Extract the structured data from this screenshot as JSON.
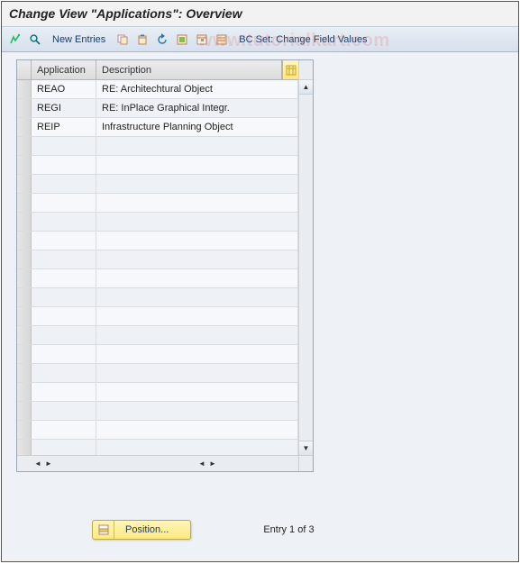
{
  "title": "Change View \"Applications\": Overview",
  "toolbar": {
    "new_entries": "New Entries",
    "bc_set": "BC Set: Change Field Values"
  },
  "grid": {
    "headers": {
      "application": "Application",
      "description": "Description"
    },
    "rows": [
      {
        "app": "REAO",
        "desc": "RE: Architechtural Object"
      },
      {
        "app": "REGI",
        "desc": "RE: InPlace Graphical Integr."
      },
      {
        "app": "REIP",
        "desc": "Infrastructure Planning Object"
      }
    ],
    "empty_row_count": 17
  },
  "footer": {
    "position_label": "Position...",
    "entry_text": "Entry 1 of 3"
  },
  "watermark": "www.tutorialkart.com"
}
